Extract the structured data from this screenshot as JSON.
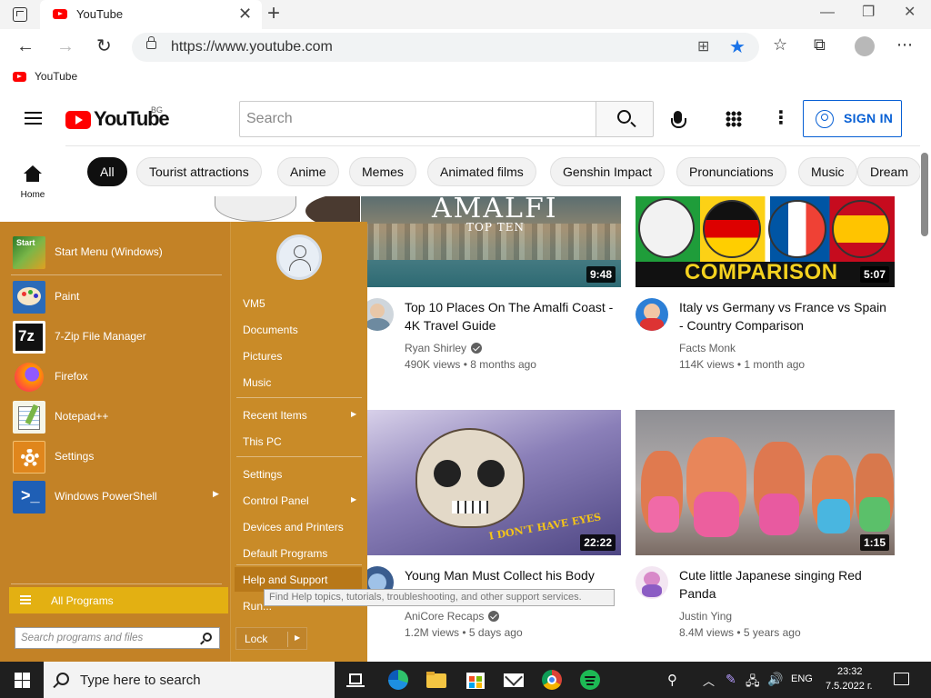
{
  "browser": {
    "tab_title": "YouTube",
    "tab_close": "✕",
    "new_tab": "+",
    "url": "https://www.youtube.com",
    "favorites_bar_item": "YouTube",
    "nav": {
      "back": "←",
      "forward": "→",
      "refresh": "↻"
    },
    "window_controls": {
      "minimize": "—",
      "restore": "❐",
      "close": "✕"
    },
    "toolbar_icons": {
      "favorites": "☆",
      "collections": "⧉",
      "more": "⋯"
    },
    "colors": {
      "accent": "#1a73e8"
    }
  },
  "youtube": {
    "logo_text": "YouTube",
    "region_code": "BG",
    "search_placeholder": "Search",
    "signin_label": "SIGN IN",
    "more_glyph": "⋮",
    "guide_home_label": "Home",
    "chips": [
      "All",
      "Tourist attractions",
      "Anime",
      "Memes",
      "Animated films",
      "Genshin Impact",
      "Pronunciations",
      "Music",
      "Dream"
    ],
    "videos": [
      {
        "title": "Top 10 Places On The Amalfi Coast - 4K Travel Guide",
        "channel": "Ryan Shirley",
        "verified": true,
        "views": "490K views",
        "age": "8 months ago",
        "duration": "9:48",
        "thumb_text": "AMALFI",
        "thumb_subtext": "TOP TEN"
      },
      {
        "title": "Italy vs Germany vs France vs Spain - Country Comparison",
        "channel": "Facts Monk",
        "verified": false,
        "views": "114K views",
        "age": "1 month ago",
        "duration": "5:07",
        "thumb_text": "COMPARISON"
      },
      {
        "title": "Young Man Must Collect his Body Parts Sold to the Demons",
        "channel": "AniCore Recaps",
        "verified": true,
        "views": "1.2M views",
        "age": "5 days ago",
        "duration": "22:22",
        "thumb_text": "I DON'T HAVE EYES"
      },
      {
        "title": "Cute little Japanese singing Red Panda",
        "channel": "Justin Ying",
        "verified": false,
        "views": "8.4M views",
        "age": "5 years ago",
        "duration": "1:15"
      }
    ],
    "meta_separator": "•"
  },
  "start_menu": {
    "pinned": [
      {
        "label": "Start Menu (Windows)",
        "icon": "start-menu-icon",
        "icon_text": "Start"
      },
      {
        "label": "Paint",
        "icon": "paint-icon"
      },
      {
        "label": "7-Zip File Manager",
        "icon": "7zip-icon",
        "icon_text": "7z"
      },
      {
        "label": "Firefox",
        "icon": "firefox-icon"
      },
      {
        "label": "Notepad++",
        "icon": "notepadpp-icon"
      },
      {
        "label": "Settings",
        "icon": "settings-icon"
      },
      {
        "label": "Windows PowerShell",
        "icon": "powershell-icon",
        "has_submenu": true
      }
    ],
    "submenu_arrow": "▶",
    "all_programs_label": "All Programs",
    "search_placeholder": "Search programs and files",
    "right_links": [
      {
        "label": "VM5"
      },
      {
        "label": "Documents"
      },
      {
        "label": "Pictures"
      },
      {
        "label": "Music"
      },
      {
        "label": "Recent Items",
        "has_submenu": true
      },
      {
        "label": "This PC"
      },
      {
        "label": "Settings"
      },
      {
        "label": "Control Panel",
        "has_submenu": true
      },
      {
        "label": "Devices and Printers"
      },
      {
        "label": "Default Programs"
      },
      {
        "label": "Help and Support",
        "hovered": true
      },
      {
        "label": "Run..."
      }
    ],
    "lock_label": "Lock",
    "tooltip": "Find Help topics, tutorials, troubleshooting, and other support services.",
    "colors": {
      "background": "#c0852a",
      "all_programs": "#e3b012"
    }
  },
  "taskbar": {
    "search_placeholder": "Type here to search",
    "apps": [
      "task-view-icon",
      "edge-icon",
      "file-explorer-icon",
      "store-icon",
      "mail-icon",
      "chrome-icon",
      "spotify-icon"
    ],
    "tray": {
      "language": "ENG",
      "time": "23:32",
      "date": "7.5.2022 г."
    }
  }
}
